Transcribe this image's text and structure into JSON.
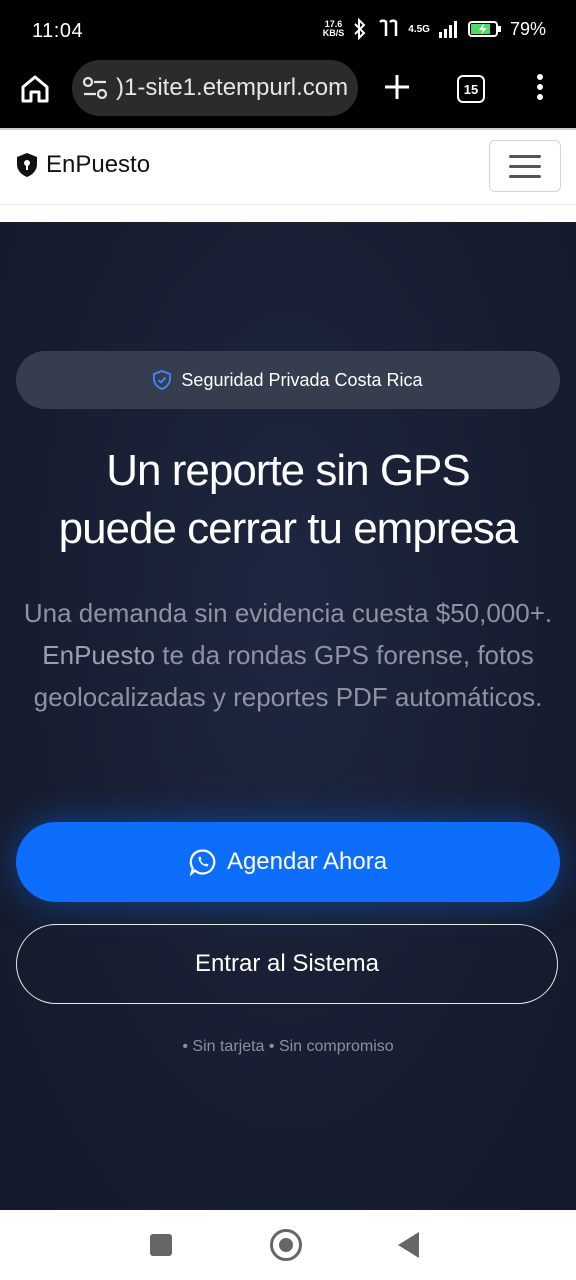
{
  "status_bar": {
    "time": "11:04",
    "speed_value": "17.6",
    "speed_unit": "KB/S",
    "network": "4.5G",
    "battery": "79%"
  },
  "browser": {
    "url": ")1-site1.etempurl.com",
    "tab_count": "15"
  },
  "navbar": {
    "brand": "EnPuesto"
  },
  "hero": {
    "badge": "Seguridad Privada Costa Rica",
    "headline_line1": "Un reporte sin GPS",
    "headline_line2": "puede cerrar tu empresa",
    "sub_line1": "Una demanda sin evidencia cuesta $50,000+.",
    "sub_brand": "EnPuesto",
    "sub_line2": " te da rondas GPS forense, fotos geolocalizadas y reportes PDF automáticos.",
    "primary_button": "Agendar Ahora",
    "secondary_button": "Entrar al Sistema",
    "footnote": "• Sin tarjeta • Sin compromiso"
  },
  "colors": {
    "hero_bg": "#1a2035",
    "primary": "#0d6efd",
    "badge_bg": "#363d4e"
  }
}
